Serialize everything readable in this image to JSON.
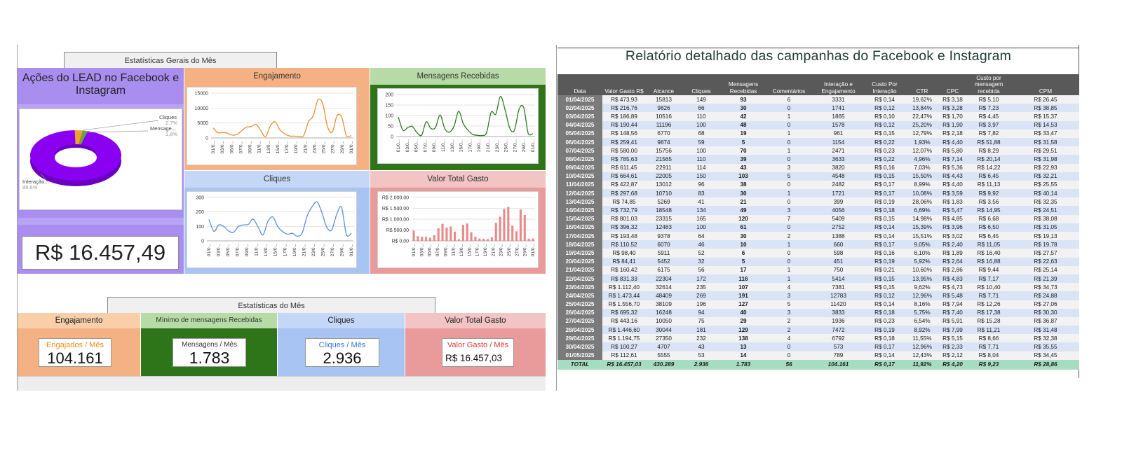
{
  "dashboard": {
    "general_tab": "Estatísticas Gerais do Mês",
    "actions_title": "Ações do LEAD no Facebook e Instagram",
    "pie_labels": {
      "cliques": "Cliques",
      "cliques_pct": "2,7%",
      "mensagens": "Mensage...",
      "mensagens_pct": "1,8%",
      "interacao": "Interação...",
      "interacao_pct": "95,6%"
    },
    "total_value": "R$ 16.457,49",
    "panels": {
      "engajamento": "Engajamento",
      "mensagens": "Mensagens Recebidas",
      "cliques": "Cliques",
      "valor": "Valor Total Gasto"
    },
    "month_tab": "Estatísticas do Mês",
    "cards": {
      "engajamento_title": "Engajamento",
      "engajamento_label": "Engajados / Mês",
      "engajamento_value": "104.161",
      "mensagens_title": "Mínimo de mensagens Recebidas",
      "mensagens_label": "Mensagens / Mês",
      "mensagens_value": "1.783",
      "cliques_title": "Cliques",
      "cliques_label": "Cliques / Mês",
      "cliques_value": "2.936",
      "valor_title": "Valor Total Gasto",
      "valor_label": "Valor Gasto / Mês",
      "valor_value": "R$ 16.457,03"
    },
    "colors": {
      "purple": "#a98ef0",
      "orange": "#f4b183",
      "green_dark": "#2e7418",
      "green_light": "#b7dba6",
      "blue": "#a8c4f2",
      "pink": "#e99a9a",
      "pink_light": "#f2c4c4"
    }
  },
  "chart_data": [
    {
      "type": "pie",
      "categories": [
        "Cliques",
        "Mensage...",
        "Interação..."
      ],
      "values": [
        2.7,
        1.8,
        95.6
      ]
    },
    {
      "type": "line",
      "title": "Engajamento",
      "x_ticks": [
        "01/0...",
        "03/0...",
        "05/0...",
        "07/0...",
        "09/0...",
        "11/0...",
        "13/0...",
        "15/0...",
        "17/0...",
        "19/0...",
        "21/0...",
        "23/0...",
        "25/0...",
        "27/0...",
        "29/0...",
        "01/0..."
      ],
      "y_ticks": [
        "15000",
        "10000",
        "5000",
        "0"
      ],
      "ylim": [
        0,
        15000
      ],
      "values": [
        3331,
        1741,
        1865,
        1578,
        961,
        1154,
        2471,
        3633,
        3820,
        4548,
        2482,
        399,
        4056,
        5409,
        2752,
        1388,
        660,
        598,
        451,
        750,
        5414,
        7381,
        12783,
        11420,
        3833,
        1936,
        7472,
        6792,
        573,
        789
      ]
    },
    {
      "type": "line",
      "title": "Mensagens Recebidas",
      "x_ticks": [
        "01/0...",
        "03/0...",
        "05/0...",
        "07/0...",
        "09/0...",
        "11/0...",
        "13/0...",
        "15/0...",
        "17/0...",
        "19/0...",
        "21/0...",
        "23/0...",
        "25/0...",
        "27/0...",
        "29/0...",
        "01/0..."
      ],
      "y_ticks": [
        "200",
        "150",
        "100",
        "50",
        "0"
      ],
      "ylim": [
        0,
        200
      ],
      "values": [
        93,
        30,
        42,
        48,
        19,
        5,
        70,
        39,
        43,
        103,
        38,
        21,
        49,
        120,
        61,
        30,
        10,
        6,
        5,
        17,
        116,
        107,
        191,
        127,
        40,
        29,
        129,
        138,
        13,
        14
      ]
    },
    {
      "type": "line",
      "title": "Cliques",
      "x_ticks": [
        "01/0...",
        "03/0...",
        "05/0...",
        "07/0...",
        "09/0...",
        "11/0...",
        "13/0...",
        "15/0...",
        "17/0...",
        "19/0...",
        "21/0...",
        "23/0...",
        "25/0...",
        "27/0...",
        "29/0...",
        "01/0..."
      ],
      "y_ticks": [
        "300",
        "200",
        "100",
        "0"
      ],
      "ylim": [
        0,
        300
      ],
      "values": [
        149,
        66,
        110,
        100,
        68,
        59,
        100,
        110,
        114,
        150,
        96,
        41,
        134,
        165,
        100,
        64,
        46,
        52,
        32,
        56,
        172,
        235,
        269,
        196,
        94,
        75,
        181,
        232,
        43,
        53
      ]
    },
    {
      "type": "bar",
      "title": "Valor Total Gasto",
      "x_ticks": [
        "01/0...",
        "03/0...",
        "05/0...",
        "07/0...",
        "09/0...",
        "11/0...",
        "13/0...",
        "15/0...",
        "17/0...",
        "19/0...",
        "21/0...",
        "23/0...",
        "25/0...",
        "27/0...",
        "29/0...",
        "01/0..."
      ],
      "y_ticks": [
        "R$ 2.000,00",
        "R$ 1.500,00",
        "R$ 1.000,00",
        "R$ 500,00",
        "R$ 0,00"
      ],
      "ylim": [
        0,
        2000
      ],
      "values": [
        473.93,
        216.76,
        186.89,
        190.44,
        148.56,
        259.41,
        580.0,
        785.63,
        611.45,
        664.61,
        422.87,
        74.85,
        732.79,
        801.03,
        396.32,
        193.48,
        110.52,
        98.4,
        84.41,
        160.42,
        831.33,
        1112.4,
        1473.44,
        1556.7,
        695.32,
        443.16,
        1446.6,
        1194.75,
        100.27,
        112.61
      ]
    }
  ],
  "report": {
    "title": "Relatório detalhado das campanhas do Facebook e Instagram",
    "headers": [
      "Data",
      "Valor Gasto R$",
      "Alcance",
      "Cliques",
      "Mensagens Recebidas",
      "Comentários",
      "Interação e Engajamento",
      "Custo Por Interação",
      "CTR",
      "CPC",
      "Custo por mensagem recebida",
      "CPM"
    ],
    "rows": [
      [
        "01/04/2025",
        "R$ 473,93",
        "15813",
        "149",
        "93",
        "6",
        "3331",
        "R$ 0,14",
        "19,62%",
        "R$ 3,18",
        "R$ 5,10",
        "R$ 26,45"
      ],
      [
        "02/04/2025",
        "R$ 216,76",
        "9826",
        "66",
        "30",
        "0",
        "1741",
        "R$ 0,12",
        "13,84%",
        "R$ 3,28",
        "R$ 7,23",
        "R$ 38,85"
      ],
      [
        "03/04/2025",
        "R$ 186,89",
        "10516",
        "110",
        "42",
        "1",
        "1865",
        "R$ 0,10",
        "22,47%",
        "R$ 1,70",
        "R$ 4,45",
        "R$ 15,37"
      ],
      [
        "04/04/2025",
        "R$ 190,44",
        "11196",
        "100",
        "48",
        "0",
        "1578",
        "R$ 0,12",
        "25,20%",
        "R$ 1,90",
        "R$ 3,97",
        "R$ 14,53"
      ],
      [
        "05/04/2025",
        "R$ 148,56",
        "6770",
        "68",
        "19",
        "1",
        "961",
        "R$ 0,15",
        "12,79%",
        "R$ 2,18",
        "R$ 7,82",
        "R$ 33,47"
      ],
      [
        "06/04/2025",
        "R$ 259,41",
        "9874",
        "59",
        "5",
        "0",
        "1154",
        "R$ 0,22",
        "1,93%",
        "R$ 4,40",
        "R$ 51,88",
        "R$ 31,58"
      ],
      [
        "07/04/2025",
        "R$ 580,00",
        "15756",
        "100",
        "70",
        "1",
        "2471",
        "R$ 0,23",
        "12,07%",
        "R$ 5,80",
        "R$ 8,29",
        "R$ 29,51"
      ],
      [
        "08/04/2025",
        "R$ 785,63",
        "21565",
        "110",
        "39",
        "0",
        "3633",
        "R$ 0,22",
        "4,96%",
        "R$ 7,14",
        "R$ 20,14",
        "R$ 31,98"
      ],
      [
        "09/04/2025",
        "R$ 611,45",
        "22911",
        "114",
        "43",
        "3",
        "3820",
        "R$ 0,16",
        "7,03%",
        "R$ 5,36",
        "R$ 14,22",
        "R$ 22,93"
      ],
      [
        "10/04/2025",
        "R$ 664,61",
        "22005",
        "150",
        "103",
        "5",
        "4548",
        "R$ 0,15",
        "15,50%",
        "R$ 4,43",
        "R$ 6,45",
        "R$ 32,21"
      ],
      [
        "11/04/2025",
        "R$ 422,87",
        "13012",
        "96",
        "38",
        "0",
        "2482",
        "R$ 0,17",
        "8,99%",
        "R$ 4,40",
        "R$ 11,13",
        "R$ 25,55"
      ],
      [
        "12/04/2025",
        "R$ 297,68",
        "10710",
        "83",
        "30",
        "1",
        "1721",
        "R$ 0,17",
        "10,08%",
        "R$ 3,59",
        "R$ 9,92",
        "R$ 40,14"
      ],
      [
        "13/04/2025",
        "R$ 74,85",
        "5269",
        "41",
        "21",
        "0",
        "399",
        "R$ 0,19",
        "28,06%",
        "R$ 1,83",
        "R$ 3,56",
        "R$ 32,35"
      ],
      [
        "14/04/2025",
        "R$ 732,79",
        "18548",
        "134",
        "49",
        "3",
        "4056",
        "R$ 0,18",
        "6,69%",
        "R$ 5,47",
        "R$ 14,95",
        "R$ 24,51"
      ],
      [
        "15/04/2025",
        "R$ 801,03",
        "23315",
        "165",
        "120",
        "7",
        "5409",
        "R$ 0,15",
        "14,98%",
        "R$ 4,85",
        "R$ 6,68",
        "R$ 38,08"
      ],
      [
        "16/04/2025",
        "R$ 396,32",
        "12483",
        "100",
        "61",
        "0",
        "2752",
        "R$ 0,14",
        "15,39%",
        "R$ 3,96",
        "R$ 6,50",
        "R$ 31,05"
      ],
      [
        "17/04/2025",
        "R$ 193,48",
        "9378",
        "64",
        "30",
        "2",
        "1388",
        "R$ 0,14",
        "15,51%",
        "R$ 3,02",
        "R$ 6,45",
        "R$ 19,13"
      ],
      [
        "18/04/2025",
        "R$ 110,52",
        "6070",
        "46",
        "10",
        "1",
        "660",
        "R$ 0,17",
        "9,05%",
        "R$ 2,40",
        "R$ 11,05",
        "R$ 19,78"
      ],
      [
        "19/04/2025",
        "R$ 98,40",
        "5911",
        "52",
        "6",
        "0",
        "598",
        "R$ 0,16",
        "6,10%",
        "R$ 1,89",
        "R$ 16,40",
        "R$ 27,57"
      ],
      [
        "20/04/2025",
        "R$ 84,41",
        "5452",
        "32",
        "5",
        "0",
        "451",
        "R$ 0,19",
        "5,92%",
        "R$ 2,64",
        "R$ 16,88",
        "R$ 22,63"
      ],
      [
        "21/04/2025",
        "R$ 160,42",
        "6175",
        "56",
        "17",
        "1",
        "750",
        "R$ 0,21",
        "10,60%",
        "R$ 2,86",
        "R$ 9,44",
        "R$ 25,14"
      ],
      [
        "22/04/2025",
        "R$ 831,33",
        "22304",
        "172",
        "116",
        "1",
        "5414",
        "R$ 0,15",
        "13,95%",
        "R$ 4,83",
        "R$ 7,17",
        "R$ 21,39"
      ],
      [
        "23/04/2025",
        "R$ 1.112,40",
        "32614",
        "235",
        "107",
        "4",
        "7381",
        "R$ 0,15",
        "9,62%",
        "R$ 4,73",
        "R$ 10,40",
        "R$ 34,73"
      ],
      [
        "24/04/2025",
        "R$ 1.473,44",
        "48409",
        "269",
        "191",
        "3",
        "12783",
        "R$ 0,12",
        "12,96%",
        "R$ 5,48",
        "R$ 7,71",
        "R$ 24,88"
      ],
      [
        "25/04/2025",
        "R$ 1.556,70",
        "38109",
        "196",
        "127",
        "5",
        "11420",
        "R$ 0,14",
        "8,16%",
        "R$ 7,94",
        "R$ 12,26",
        "R$ 27,06"
      ],
      [
        "26/04/2025",
        "R$ 695,32",
        "16248",
        "94",
        "40",
        "3",
        "3833",
        "R$ 0,18",
        "5,75%",
        "R$ 7,40",
        "R$ 17,38",
        "R$ 30,30"
      ],
      [
        "27/04/2025",
        "R$ 443,16",
        "10050",
        "75",
        "29",
        "2",
        "1936",
        "R$ 0,23",
        "6,54%",
        "R$ 5,91",
        "R$ 15,28",
        "R$ 36,87"
      ],
      [
        "28/04/2025",
        "R$ 1.446,60",
        "30044",
        "181",
        "129",
        "2",
        "7472",
        "R$ 0,19",
        "8,92%",
        "R$ 7,99",
        "R$ 11,21",
        "R$ 31,48"
      ],
      [
        "29/04/2025",
        "R$ 1.194,75",
        "27350",
        "232",
        "138",
        "4",
        "6792",
        "R$ 0,18",
        "11,55%",
        "R$ 5,15",
        "R$ 8,66",
        "R$ 32,38"
      ],
      [
        "30/04/2025",
        "R$ 100,27",
        "4707",
        "43",
        "13",
        "0",
        "573",
        "R$ 0,17",
        "12,96%",
        "R$ 2,33",
        "R$ 7,71",
        "R$ 35,55"
      ],
      [
        "01/05/2025",
        "R$ 112,61",
        "5555",
        "53",
        "14",
        "0",
        "789",
        "R$ 0,14",
        "12,43%",
        "R$ 2,12",
        "R$ 8,04",
        "R$ 34,45"
      ]
    ],
    "total": [
      "TOTAL",
      "R$ 16.457,03",
      "430.289",
      "2.936",
      "1.783",
      "56",
      "104.161",
      "R$ 0,17",
      "11,92%",
      "R$ 4,20",
      "R$ 9,23",
      "R$ 28,86"
    ]
  }
}
